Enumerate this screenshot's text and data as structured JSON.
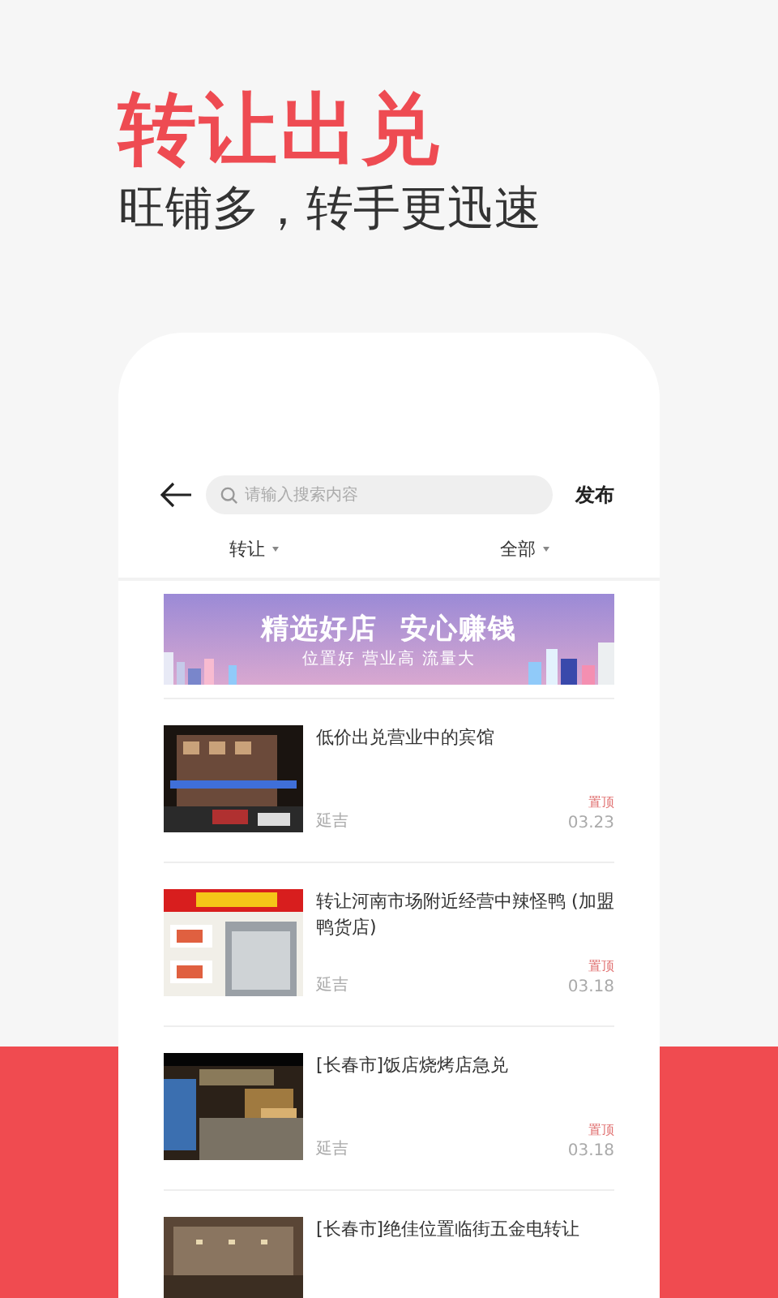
{
  "header": {
    "title": "转让出兑",
    "subtitle": "旺铺多，转手更迅速"
  },
  "toolbar": {
    "search": {
      "placeholder": "请输入搜索内容"
    },
    "action": "发布"
  },
  "filters": [
    {
      "label": "转让"
    },
    {
      "label": "全部"
    }
  ],
  "banner": {
    "headline": "精选好店  安心赚钱",
    "tagline": "位置好 营业高 流量大"
  },
  "listings": [
    {
      "title": "低价出兑营业中的宾馆",
      "pinned_label": "置顶",
      "location": "延吉",
      "date": "03.23"
    },
    {
      "title": "转让河南市场附近经营中辣怪鸭 (加盟鸭货店)",
      "pinned_label": "置顶",
      "location": "延吉",
      "date": "03.18"
    },
    {
      "title": "[长春市]饭店烧烤店急兑",
      "pinned_label": "置顶",
      "location": "延吉",
      "date": "03.18"
    },
    {
      "title": "[长春市]绝佳位置临街五金电转让"
    }
  ]
}
